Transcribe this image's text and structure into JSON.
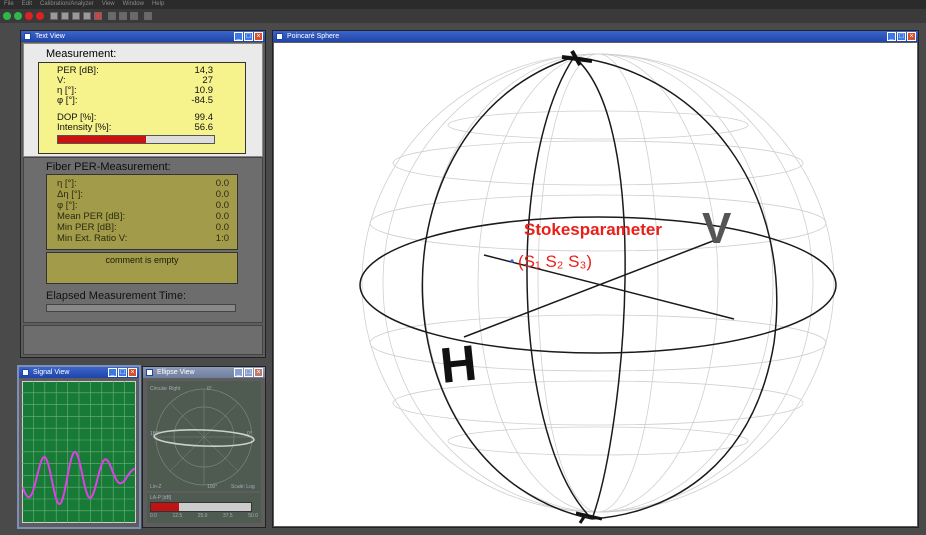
{
  "menu": {
    "items": [
      "File",
      "Edit",
      "Calibration/Analyzer",
      "View",
      "Window",
      "Help"
    ]
  },
  "toolbar": {
    "buttons": [
      "record-icon",
      "stop-icon",
      "pause-icon",
      "save-icon",
      "open-icon",
      "print-icon",
      "settings-icon",
      "chart-icon",
      "grid-icon",
      "table-icon",
      "config-icon",
      "help-icon"
    ]
  },
  "text_view": {
    "title": "Text View",
    "measurement_title": "Measurement:",
    "measurement": [
      {
        "label": "PER [dB]:",
        "value": "14,3"
      },
      {
        "label": "V:",
        "value": "27"
      },
      {
        "label": "η [°]:",
        "value": "10.9"
      },
      {
        "label": "φ [°]:",
        "value": "-84.5"
      },
      {
        "label": "DOP [%]:",
        "value": "99.4"
      },
      {
        "label": "Intensity [%]:",
        "value": "56.6"
      }
    ],
    "intensity_fraction": 0.566,
    "fiber_title": "Fiber PER-Measurement:",
    "fiber": [
      {
        "label": "η [°]:",
        "value": "0.0"
      },
      {
        "label": "Δη [°]:",
        "value": "0.0"
      },
      {
        "label": "φ [°]:",
        "value": "0.0"
      },
      {
        "label": "Mean PER [dB]:",
        "value": "0.0"
      },
      {
        "label": "Min  PER [dB]:",
        "value": "0.0"
      },
      {
        "label": "Min Ext. Ratio V:",
        "value": "1:0"
      }
    ],
    "comment": "comment is empty",
    "elapsed_title": "Elapsed Measurement Time:",
    "elapsed_fraction": 0
  },
  "signal_view": {
    "title": "Signal View"
  },
  "ellipse_view": {
    "title": "Ellipse View",
    "top_left": "Circular  Right",
    "top_mid": "0°",
    "left_axis": "180°",
    "right_axis": "0°",
    "bottom_left": "Lin-Z",
    "bottom_mid": "100°",
    "bottom_right": "Scale: Log",
    "per_label": "LA-P [dB]",
    "scale": [
      "0.0",
      "12.5",
      "25.0",
      "37.5",
      "50.0"
    ],
    "per_fraction": 0.28
  },
  "poincare": {
    "title": "Poincaré Sphere",
    "label_line1": "Stokesparameter",
    "label_line2": "(S₁ S₂ S₃)",
    "marker_H": "H",
    "marker_V": "V"
  },
  "colors": {
    "titlebar": "#1f44a8",
    "yellow_panel": "#f6f28c",
    "olive_panel": "#a29c4a",
    "intensity_bar": "#cc1111",
    "signal_bg": "#177a36",
    "signal_trace": "#e040e8",
    "label_red": "#e8201a"
  }
}
